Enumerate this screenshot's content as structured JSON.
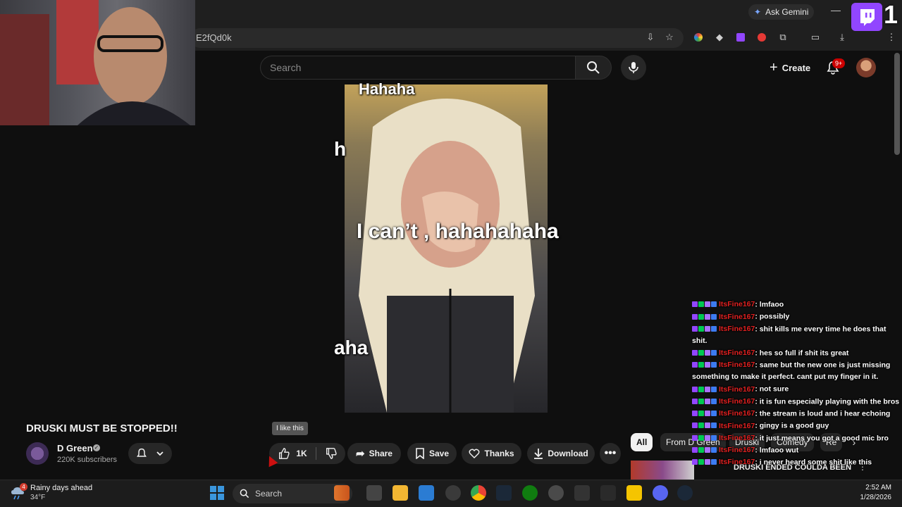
{
  "browser": {
    "ask_gemini": "Ask Gemini",
    "url": "E2fQd0k",
    "minimize": "—"
  },
  "youtube": {
    "search_placeholder": "Search",
    "create_label": "Create",
    "notification_count": "9+"
  },
  "video": {
    "caption_top": "Hahaha",
    "caption_middle": "I can’t , hahahahaha",
    "caption_left_1": "h",
    "caption_left_2": "aha",
    "title": "DRUSKI MUST BE STOPPED!!",
    "channel_name": "D Green",
    "subscribers": "220K subscribers",
    "tooltip": "I like this",
    "like_count": "1K",
    "share_label": "Share",
    "save_label": "Save",
    "thanks_label": "Thanks",
    "download_label": "Download",
    "more_label": "•••"
  },
  "chips": [
    "All",
    "From D Green",
    "Druski",
    "Comedy",
    "Re"
  ],
  "recommended": {
    "title": "DRUSKI ENDED COULDA BEEN",
    "menu": "⋮"
  },
  "chat": [
    {
      "user": "ItsFine167",
      "text": ": lmfaoo"
    },
    {
      "user": "ItsFine167",
      "text": ": possibly"
    },
    {
      "user": "ItsFine167",
      "text": ": shit kills me every time he does that shit."
    },
    {
      "user": "ItsFine167",
      "text": ": hes so full if shit its great"
    },
    {
      "user": "ItsFine167",
      "text": ": same but the new one is just missing something to make it perfect. cant put my finger in it."
    },
    {
      "user": "ItsFine167",
      "text": ": not sure"
    },
    {
      "user": "ItsFine167",
      "text": ": it is fun especially playing with the bros"
    },
    {
      "user": "ItsFine167",
      "text": ": the stream is loud and i hear echoing"
    },
    {
      "user": "ItsFine167",
      "text": ": gingy is a good guy"
    },
    {
      "user": "ItsFine167",
      "text": ": it just means you got a good mic bro"
    },
    {
      "user": "ItsFine167",
      "text": ": lmfaoo wut"
    },
    {
      "user": "ItsFine167",
      "text": ": i never heard some shit like this"
    }
  ],
  "twitch_overlay": {
    "number": "1"
  },
  "taskbar": {
    "weather_text": "Rainy days ahead",
    "weather_temp": "34°F",
    "weather_badge": "4",
    "search_label": "Search",
    "time": "2:52 AM",
    "date": "1/28/2026"
  },
  "colors": {
    "youtube_bg": "#0f0f0f",
    "chip_active": "#f1f1f1",
    "chat_username": "#e02020",
    "twitch_purple": "#9146ff"
  }
}
